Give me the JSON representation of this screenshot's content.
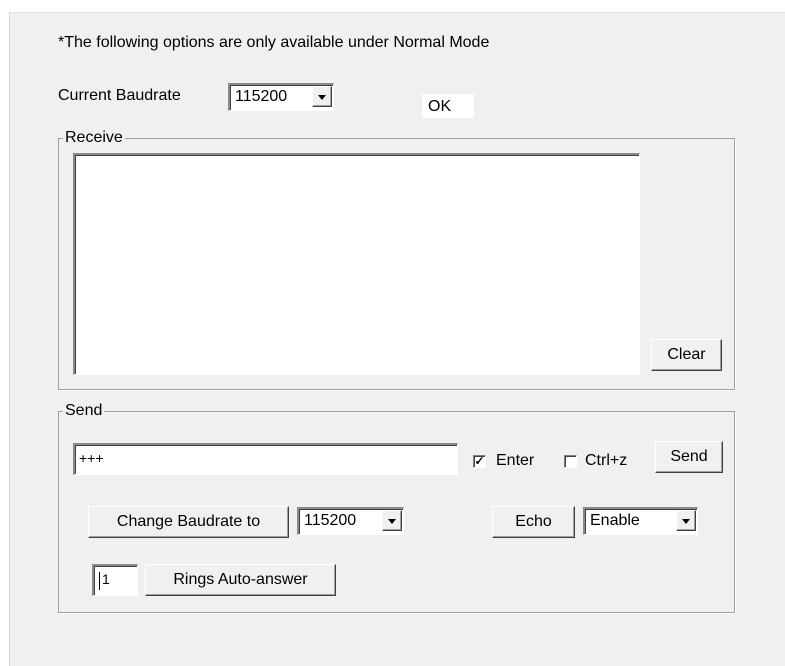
{
  "notice": "*The following options are only available under Normal Mode",
  "current_baudrate": {
    "label": "Current Baudrate",
    "value": "115200"
  },
  "status_text": "OK",
  "receive": {
    "title": "Receive",
    "text": "",
    "clear_label": "Clear"
  },
  "send": {
    "title": "Send",
    "input_value": "+++",
    "enter": {
      "label": "Enter",
      "checked": true,
      "mark": "✓"
    },
    "ctrlz": {
      "label": "Ctrl+z",
      "checked": false,
      "mark": ""
    },
    "send_label": "Send"
  },
  "change_baudrate": {
    "button_label": "Change Baudrate to",
    "value": "115200"
  },
  "echo": {
    "button_label": "Echo",
    "value": "Enable"
  },
  "rings": {
    "value": "1",
    "button_label": "Rings Auto-answer"
  },
  "icons": {
    "dropdown": "chevron-down-icon",
    "checkbox_mark": "checkmark-icon"
  }
}
